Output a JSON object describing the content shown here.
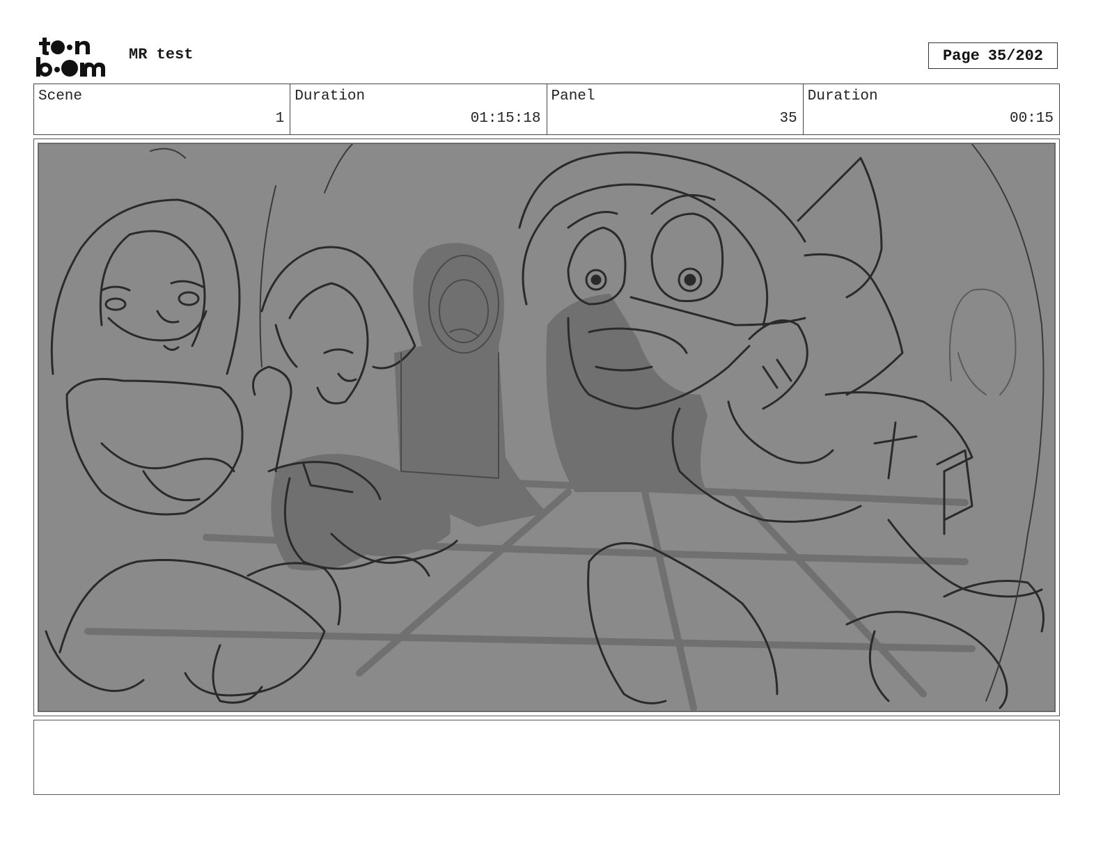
{
  "header": {
    "logo_alt": "toon boom",
    "title": "MR test",
    "page_label": "Page",
    "page_number": "35/202"
  },
  "info": [
    {
      "label": "Scene",
      "value": "1"
    },
    {
      "label": "Duration",
      "value": "01:15:18"
    },
    {
      "label": "Panel",
      "value": "35"
    },
    {
      "label": "Duration",
      "value": "00:15"
    }
  ],
  "panel": {
    "content": "storyboard-sketch",
    "background_color": "#8a8a8a",
    "line_color": "#2a2a2a"
  },
  "notes": {
    "text": ""
  }
}
